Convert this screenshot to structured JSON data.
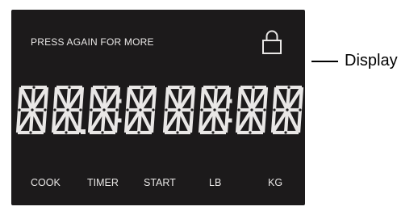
{
  "panel": {
    "prompt": "PRESS AGAIN FOR MORE",
    "lock_icon": "lock-icon",
    "segment_digits": 8,
    "labels": [
      "COOK",
      "TIMER",
      "START",
      "LB",
      "KG"
    ]
  },
  "callout": {
    "label": "Display"
  },
  "colors": {
    "panel": "#1c1a1b",
    "segment": "#e9e7e6",
    "callout": "#000000"
  }
}
